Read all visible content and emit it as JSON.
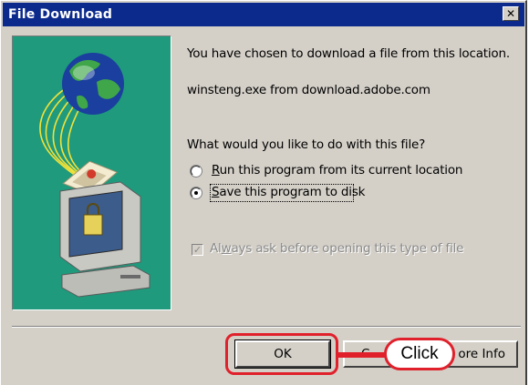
{
  "window": {
    "title": "File Download",
    "close_glyph": "✕"
  },
  "message": {
    "intro": "You have chosen to download a file from this location.",
    "source": "winsteng.exe from download.adobe.com",
    "question": "What would you like to do with this file?"
  },
  "options": [
    {
      "label": "Run this program from its current location",
      "mnemonic": "R",
      "rest": "un this program from its current location",
      "selected": false
    },
    {
      "label": "Save this program to disk",
      "mnemonic": "S",
      "rest": "ave this program to disk",
      "selected": true
    }
  ],
  "always_ask": {
    "label": "Always ask before opening this type of file",
    "pre": "Al",
    "mnemonic": "w",
    "post": "ays ask before opening this type of file",
    "checked": true,
    "disabled": true
  },
  "buttons": {
    "ok": "OK",
    "cancel_partial": "C",
    "more_info_partial": "ore Info"
  },
  "annotation": {
    "callout": "Click",
    "color": "#e0212c"
  },
  "illustration": {
    "icons": [
      "globe-icon",
      "envelope-icon",
      "computer-icon"
    ],
    "background": "#1f9a7c"
  },
  "colors": {
    "titlebar": "#0b2a8c",
    "face": "#d4d0c8"
  }
}
